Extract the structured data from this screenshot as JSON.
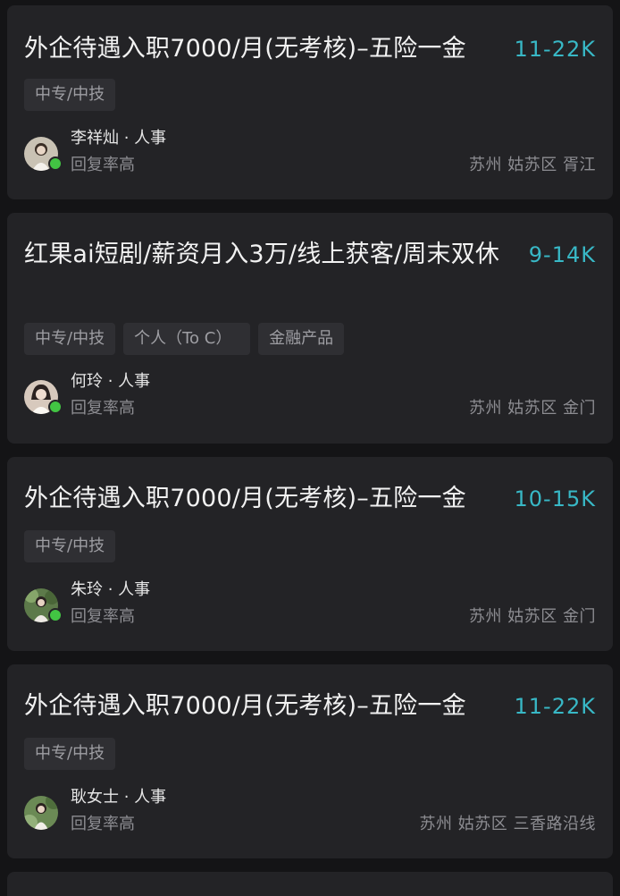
{
  "jobs": [
    {
      "title": "外企待遇入职7000/月(无考核)–五险一金",
      "salary": "11-22K",
      "tags": [
        "中专/中技"
      ],
      "recruiter": {
        "name": "李祥灿 · 人事",
        "status": "回复率高",
        "online": true
      },
      "location": "苏州 姑苏区 胥江"
    },
    {
      "title": "红果ai短剧/薪资月入3万/线上获客/周末双休",
      "salary": "9-14K",
      "tags": [
        "中专/中技",
        "个人（To C）",
        "金融产品"
      ],
      "recruiter": {
        "name": "何玲 · 人事",
        "status": "回复率高",
        "online": true
      },
      "location": "苏州 姑苏区 金门"
    },
    {
      "title": "外企待遇入职7000/月(无考核)–五险一金",
      "salary": "10-15K",
      "tags": [
        "中专/中技"
      ],
      "recruiter": {
        "name": "朱玲 · 人事",
        "status": "回复率高",
        "online": true
      },
      "location": "苏州 姑苏区 金门"
    },
    {
      "title": "外企待遇入职7000/月(无考核)–五险一金",
      "salary": "11-22K",
      "tags": [
        "中专/中技"
      ],
      "recruiter": {
        "name": "耿女士 · 人事",
        "status": "回复率高",
        "online": false
      },
      "location": "苏州 姑苏区 三香路沿线"
    }
  ],
  "colors": {
    "background": "#141416",
    "card": "#232326",
    "salary": "#38b8c6",
    "online": "#42c443"
  }
}
